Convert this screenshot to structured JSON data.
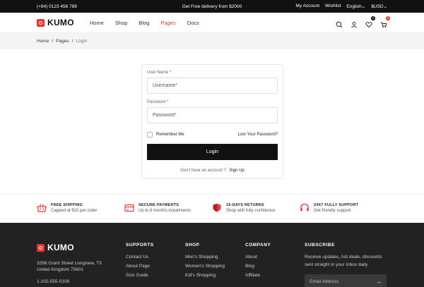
{
  "topbar": {
    "phone": "(+84) 0123 456 789",
    "promo": "Get Free delivery from $2000",
    "my_account": "My Account",
    "wishlist": "Wishlist",
    "language": "English",
    "currency": "$USD"
  },
  "header": {
    "logo": "KUMO",
    "nav": [
      "Home",
      "Shop",
      "Blog",
      "Pages",
      "Docs"
    ],
    "active_nav": "Pages",
    "wishlist_count": "0",
    "cart_count": "0"
  },
  "breadcrumb": {
    "home": "Home",
    "pages": "Pages",
    "current": "Login"
  },
  "login": {
    "username_label": "User Name *",
    "username_placeholder": "Username*",
    "password_label": "Password *",
    "password_placeholder": "Password*",
    "remember": "Remember Me",
    "lost": "Lost Your Password?",
    "submit": "Login",
    "no_account": "Don't have an account ?",
    "signup": "Sign Up"
  },
  "features": [
    {
      "title": "FREE SHIPPING",
      "sub": "Capped at $10 per order"
    },
    {
      "title": "SECURE PAYMENTS",
      "sub": "Up to 6 months installments"
    },
    {
      "title": "15-DAYS RETURNS",
      "sub": "Shop with fully confidence"
    },
    {
      "title": "24X7 FULLY SUPPORT",
      "sub": "Get friendly support"
    }
  ],
  "footer": {
    "logo": "KUMO",
    "address1": "3298 Grant Street Longview, TX",
    "address2": "United Kingdom 75601",
    "phone": "1-202-555-0106",
    "supports": {
      "title": "SUPPORTS",
      "items": [
        "Contact Us",
        "About Page",
        "Size Guide"
      ]
    },
    "shop": {
      "title": "SHOP",
      "items": [
        "Men's Shopping",
        "Women's Shopping",
        "Kid's Shopping"
      ]
    },
    "company": {
      "title": "COMPANY",
      "items": [
        "About",
        "Blog",
        "Affiliate"
      ]
    },
    "subscribe": {
      "title": "SUBSCRIBE",
      "text1": "Receive updates, hot deals, discounts",
      "text2": "sent straight in your inbox daily",
      "placeholder": "Email Address"
    }
  },
  "colors": {
    "accent": "#e53935",
    "dark": "#111111",
    "footer": "#222222"
  }
}
